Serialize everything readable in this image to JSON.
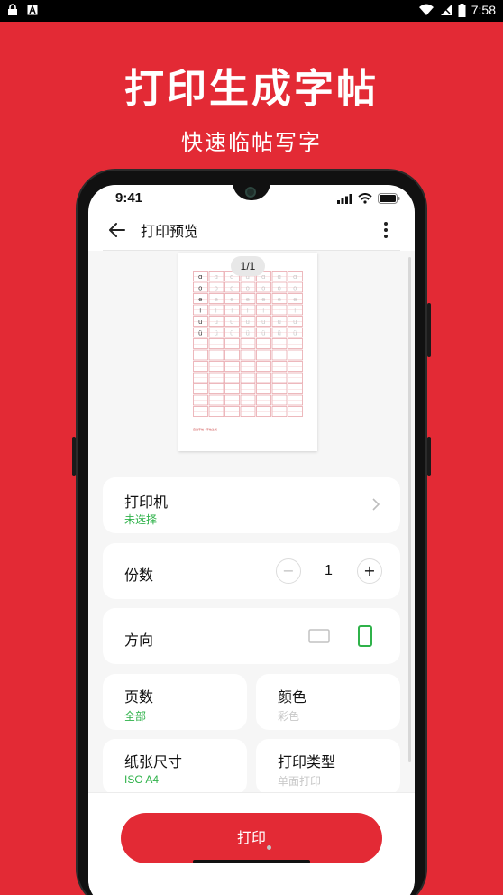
{
  "android_status": {
    "time": "7:58"
  },
  "promo": {
    "title": "打印生成字帖",
    "subtitle": "快速临帖写字"
  },
  "inner_status": {
    "time": "9:41"
  },
  "header": {
    "title": "打印预览"
  },
  "preview": {
    "page_indicator": "1/1",
    "letters": [
      "ɑ",
      "o",
      "e",
      "i",
      "u",
      "ü"
    ],
    "footer_text": "自选字帖 · 字帖生成"
  },
  "settings": {
    "printer": {
      "label": "打印机",
      "value": "未选择"
    },
    "copies": {
      "label": "份数",
      "value": "1",
      "minus": "−",
      "plus": "+"
    },
    "orientation": {
      "label": "方向"
    },
    "pages": {
      "label": "页数",
      "value": "全部"
    },
    "color": {
      "label": "颜色",
      "value": "彩色"
    },
    "paper_size": {
      "label": "纸张尺寸",
      "value": "ISO A4"
    },
    "print_type": {
      "label": "打印类型",
      "value": "单面打印"
    }
  },
  "actions": {
    "print_label": "打印"
  },
  "colors": {
    "brand": "#e32a35",
    "accent_green": "#2fb24a"
  }
}
